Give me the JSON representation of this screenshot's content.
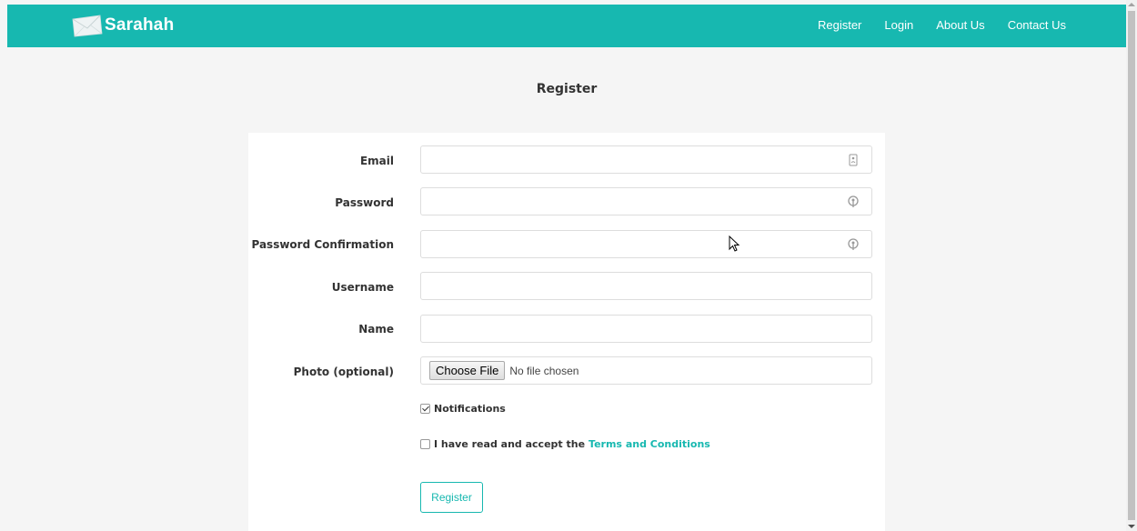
{
  "nav": {
    "brand": "Sarahah",
    "links": [
      "Register",
      "Login",
      "About Us",
      "Contact Us"
    ]
  },
  "page": {
    "title": "Register"
  },
  "form": {
    "email_label": "Email",
    "password_label": "Password",
    "password_confirm_label": "Password Confirmation",
    "username_label": "Username",
    "name_label": "Name",
    "photo_label": "Photo (optional)",
    "file_button": "Choose File",
    "file_status": "No file chosen",
    "notifications_label": "Notifications",
    "notifications_checked": true,
    "terms_prefix": "I have read and accept the",
    "terms_link": "Terms and Conditions",
    "terms_checked": false,
    "submit_label": "Register"
  },
  "colors": {
    "accent": "#17b8b0"
  },
  "icons": [
    "envelope-logo-icon",
    "contact-card-icon",
    "key-icon",
    "key-icon",
    "mouse-cursor-icon",
    "scroll-up-arrow-icon",
    "scroll-down-arrow-icon"
  ]
}
